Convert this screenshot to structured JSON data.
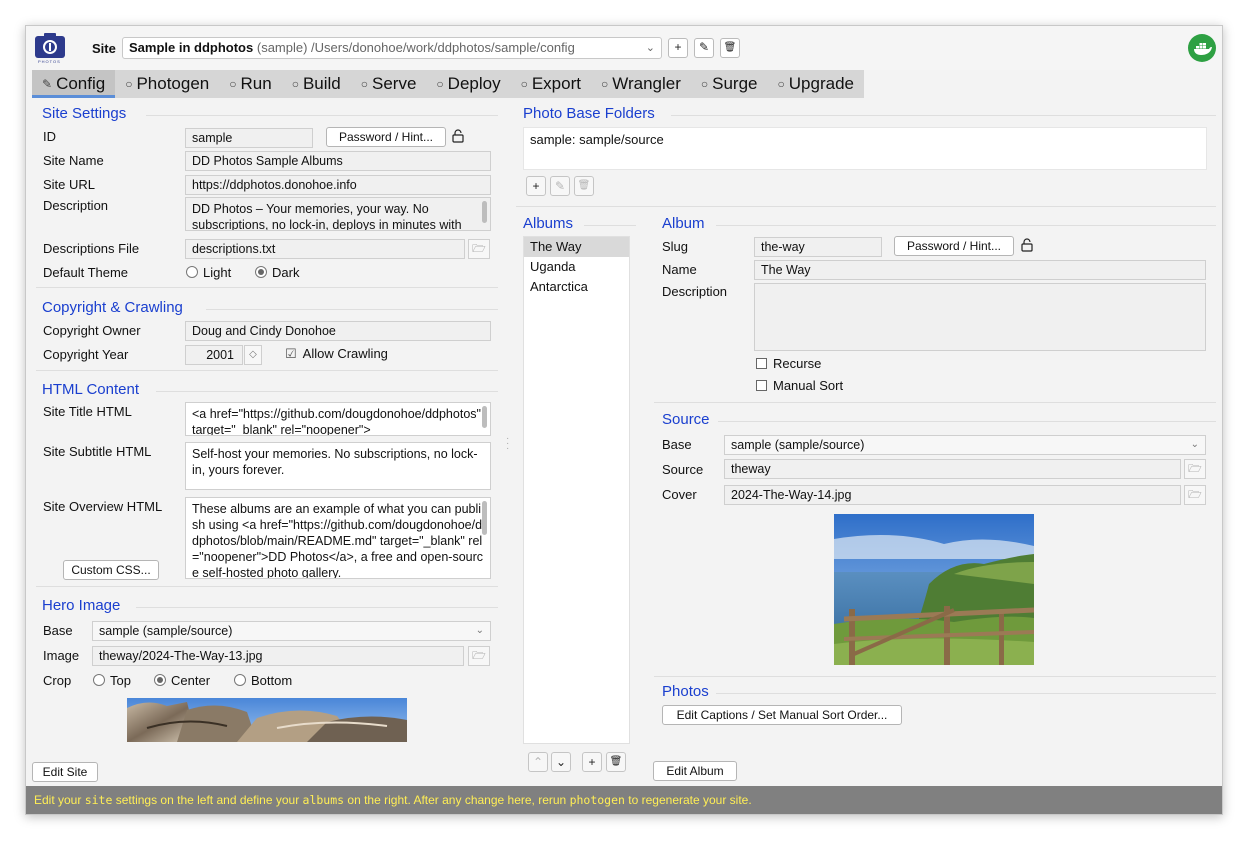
{
  "site_bar": {
    "label": "Site",
    "site_name": "Sample in ddphotos",
    "site_meta": "(sample) /Users/donohoe/work/ddphotos/sample/config",
    "logo_text": "PHOTOS",
    "logo_glyph": "ⓘ",
    "add_icon": "+",
    "edit_icon": "✎",
    "delete_icon": "🗑",
    "chevron_icon": "⌄",
    "docker_icon": "docker-icon"
  },
  "tabs": [
    {
      "label": "Config",
      "icon": "✎",
      "active": true
    },
    {
      "label": "Photogen",
      "icon": "○",
      "active": false
    },
    {
      "label": "Run",
      "icon": "○",
      "active": false
    },
    {
      "label": "Build",
      "icon": "○",
      "active": false
    },
    {
      "label": "Serve",
      "icon": "○",
      "active": false
    },
    {
      "label": "Deploy",
      "icon": "○",
      "active": false
    },
    {
      "label": "Export",
      "icon": "○",
      "active": false
    },
    {
      "label": "Wrangler",
      "icon": "○",
      "active": false
    },
    {
      "label": "Surge",
      "icon": "○",
      "active": false
    },
    {
      "label": "Upgrade",
      "icon": "○",
      "active": false
    }
  ],
  "site_settings": {
    "title": "Site Settings",
    "id_label": "ID",
    "id_value": "sample",
    "password_button": "Password / Hint...",
    "lock_icon": "🔓",
    "site_name_label": "Site Name",
    "site_name_value": "DD Photos Sample Albums",
    "site_url_label": "Site URL",
    "site_url_value": "https://ddphotos.donohoe.info",
    "description_label": "Description",
    "description_value": "DD Photos – Your memories, your way. No subscriptions, no lock-in, deploys in minutes with Tu...",
    "descriptions_file_label": "Descriptions File",
    "descriptions_file_value": "descriptions.txt",
    "folder_icon": "🗁",
    "default_theme_label": "Default Theme",
    "theme_light": "Light",
    "theme_dark": "Dark"
  },
  "copyright": {
    "title": "Copyright & Crawling",
    "owner_label": "Copyright Owner",
    "owner_value": "Doug and Cindy Donohoe",
    "year_label": "Copyright Year",
    "year_value": "2001",
    "stepper_icon": "◇",
    "allow_crawling": "Allow Crawling",
    "check_mark": "☑"
  },
  "html_content": {
    "title": "HTML Content",
    "site_title_label": "Site Title HTML",
    "site_title_value": "<a href=\"https://github.com/dougdonohoe/ddphotos\" target=\"_blank\" rel=\"noopener\">",
    "site_subtitle_label": "Site Subtitle HTML",
    "site_subtitle_value": "Self-host your memories. No subscriptions, no lock-in, yours forever.",
    "site_overview_label": "Site Overview HTML",
    "site_overview_value": "These albums are an example of what you can publish using  <a href=\"https://github.com/dougdonohoe/ddphotos/blob/main/README.md\" target=\"_blank\" rel=\"noopener\">DD Photos</a>,  a free and open-source self-hosted photo gallery.",
    "custom_css_button": "Custom CSS..."
  },
  "hero_image": {
    "title": "Hero Image",
    "base_label": "Base",
    "base_value": "sample (sample/source)",
    "image_label": "Image",
    "image_value": "theway/2024-The-Way-13.jpg",
    "crop_label": "Crop",
    "crop_top": "Top",
    "crop_center": "Center",
    "crop_bottom": "Bottom"
  },
  "edit_site_button": "Edit Site",
  "photo_base_folders": {
    "title": "Photo Base Folders",
    "items": [
      "sample: sample/source"
    ]
  },
  "albums": {
    "title": "Albums",
    "items": [
      "The Way",
      "Uganda",
      "Antarctica"
    ],
    "selected": "The Way",
    "up_icon": "⌃",
    "down_icon": "⌄"
  },
  "album": {
    "title": "Album",
    "slug_label": "Slug",
    "slug_value": "the-way",
    "password_button": "Password / Hint...",
    "name_label": "Name",
    "name_value": "The Way",
    "description_label": "Description",
    "description_value": "",
    "recurse": "Recurse",
    "manual_sort": "Manual Sort"
  },
  "source": {
    "title": "Source",
    "base_label": "Base",
    "base_value": "sample (sample/source)",
    "source_label": "Source",
    "source_value": "theway",
    "cover_label": "Cover",
    "cover_value": "2024-The-Way-14.jpg"
  },
  "photos": {
    "title": "Photos",
    "edit_button": "Edit Captions / Set Manual Sort Order..."
  },
  "edit_album_button": "Edit Album",
  "status_bar": {
    "t1": "Edit your ",
    "k1": "site",
    "t2": " settings on the left and define your ",
    "k2": "albums",
    "t3": " on the right. After any change here, rerun ",
    "k3": "photogen",
    "t4": " to regenerate your site."
  },
  "colors": {
    "section_title": "#1a3fcf",
    "status_bar_bg": "#808080",
    "status_bar_text": "#ffee55",
    "docker_green": "#2ea043",
    "tab_active_underline": "#5b8ed8"
  }
}
